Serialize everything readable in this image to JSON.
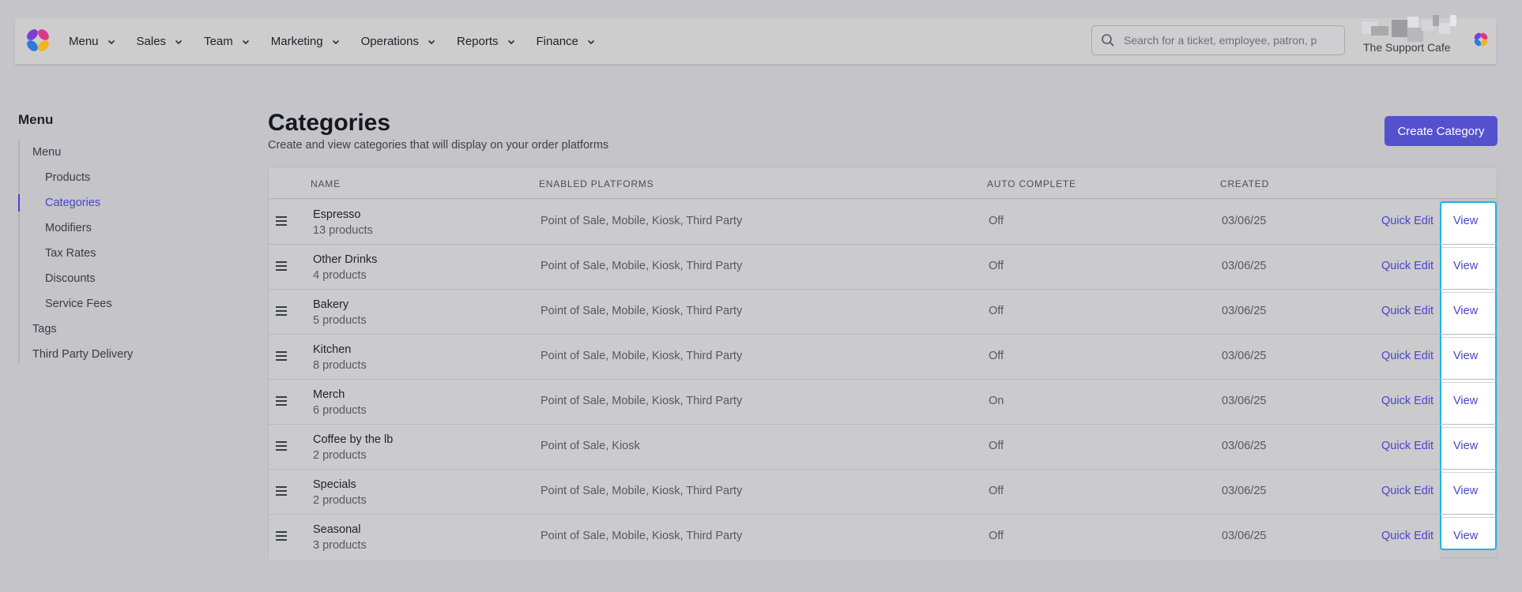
{
  "nav": {
    "items": [
      {
        "label": "Menu"
      },
      {
        "label": "Sales"
      },
      {
        "label": "Team"
      },
      {
        "label": "Marketing"
      },
      {
        "label": "Operations"
      },
      {
        "label": "Reports"
      },
      {
        "label": "Finance"
      }
    ],
    "search_placeholder": "Search for a ticket, employee, patron, p",
    "org_name": "The Support Cafe"
  },
  "sidebar": {
    "title": "Menu",
    "items": [
      {
        "label": "Menu",
        "level": 1
      },
      {
        "label": "Products",
        "level": 2
      },
      {
        "label": "Categories",
        "level": 2,
        "active": true
      },
      {
        "label": "Modifiers",
        "level": 2
      },
      {
        "label": "Tax Rates",
        "level": 2
      },
      {
        "label": "Discounts",
        "level": 2
      },
      {
        "label": "Service Fees",
        "level": 2
      },
      {
        "label": "Tags",
        "level": 1
      },
      {
        "label": "Third Party Delivery",
        "level": 1
      }
    ]
  },
  "page": {
    "title": "Categories",
    "subtitle": "Create and view categories that will display on your order platforms",
    "create_button": "Create Category"
  },
  "table": {
    "headers": {
      "name": "NAME",
      "platforms": "ENABLED PLATFORMS",
      "auto_complete": "AUTO COMPLETE",
      "created": "CREATED"
    },
    "quick_edit_label": "Quick Edit",
    "view_label": "View",
    "rows": [
      {
        "name": "Espresso",
        "count": "13 products",
        "platforms": "Point of Sale, Mobile, Kiosk, Third Party",
        "auto_complete": "Off",
        "created": "03/06/25"
      },
      {
        "name": "Other Drinks",
        "count": "4 products",
        "platforms": "Point of Sale, Mobile, Kiosk, Third Party",
        "auto_complete": "Off",
        "created": "03/06/25"
      },
      {
        "name": "Bakery",
        "count": "5 products",
        "platforms": "Point of Sale, Mobile, Kiosk, Third Party",
        "auto_complete": "Off",
        "created": "03/06/25"
      },
      {
        "name": "Kitchen",
        "count": "8 products",
        "platforms": "Point of Sale, Mobile, Kiosk, Third Party",
        "auto_complete": "Off",
        "created": "03/06/25"
      },
      {
        "name": "Merch",
        "count": "6 products",
        "platforms": "Point of Sale, Mobile, Kiosk, Third Party",
        "auto_complete": "On",
        "created": "03/06/25"
      },
      {
        "name": "Coffee by the lb",
        "count": "2 products",
        "platforms": "Point of Sale, Kiosk",
        "auto_complete": "Off",
        "created": "03/06/25"
      },
      {
        "name": "Specials",
        "count": "2 products",
        "platforms": "Point of Sale, Mobile, Kiosk, Third Party",
        "auto_complete": "Off",
        "created": "03/06/25"
      },
      {
        "name": "Seasonal",
        "count": "3 products",
        "platforms": "Point of Sale, Mobile, Kiosk, Third Party",
        "auto_complete": "Off",
        "created": "03/06/25"
      }
    ]
  },
  "colors": {
    "accent": "#4a44c9",
    "button": "#5451cf",
    "highlight": "#19b6e6",
    "background": "#c4c4c9"
  },
  "icons": [
    "app-logo-icon",
    "chevron-down-icon",
    "search-icon",
    "drag-handle-icon",
    "org-logo-icon"
  ]
}
